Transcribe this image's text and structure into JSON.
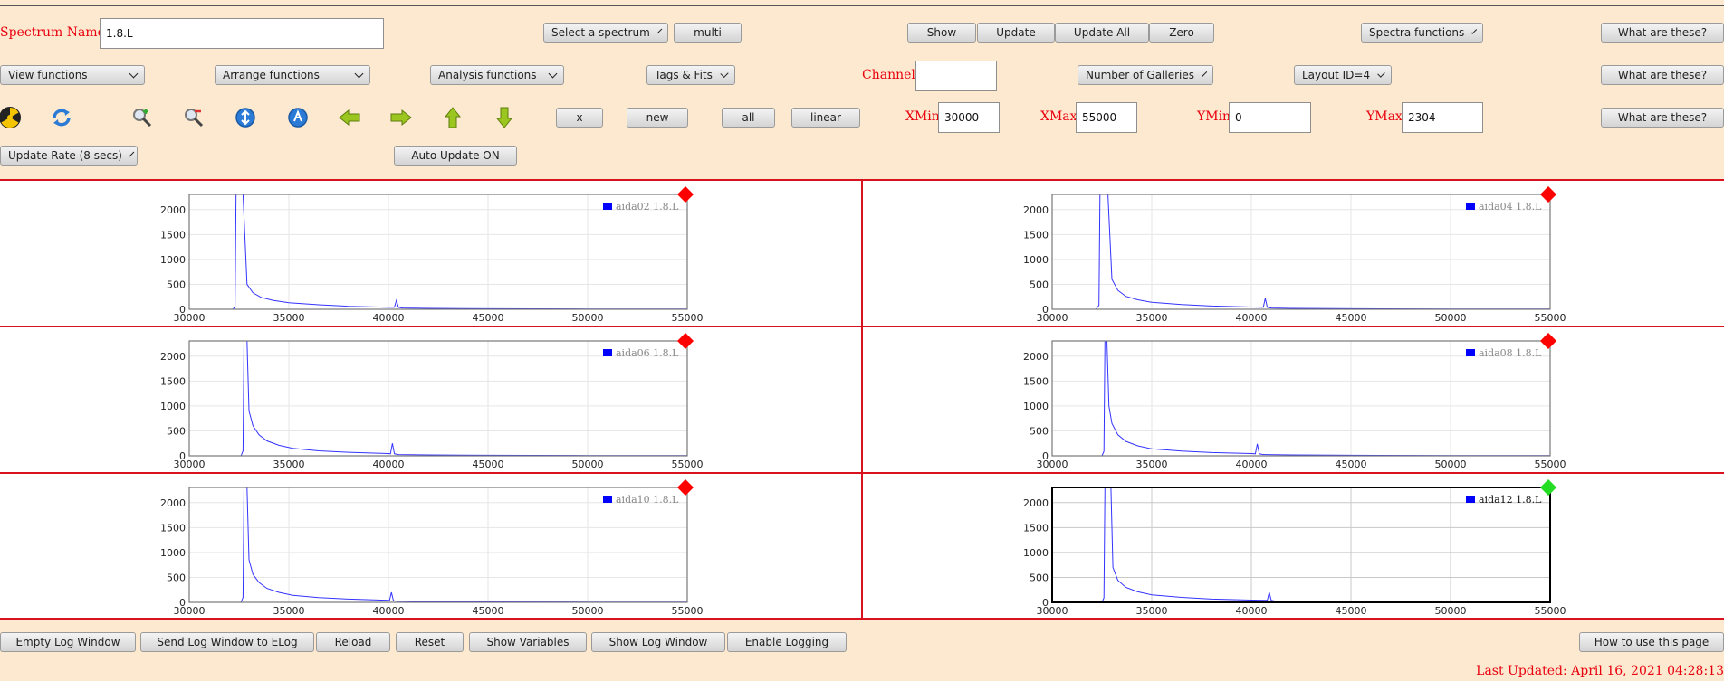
{
  "toolbar": {
    "spectrum_name_label": "Spectrum Name:",
    "spectrum_name_value": "1.8.L",
    "select_spectrum": "Select a spectrum",
    "multi": "multi",
    "show": "Show",
    "update": "Update",
    "update_all": "Update All",
    "zero": "Zero",
    "spectra_functions": "Spectra functions",
    "what_are_these": "What are these?",
    "view_functions": "View functions",
    "arrange_functions": "Arrange functions",
    "analysis_functions": "Analysis functions",
    "tags_fits": "Tags & Fits",
    "channel_label": "Channel:",
    "channel_value": "",
    "number_of_galleries": "Number of Galleries",
    "layout": "Layout ID=4",
    "x": "x",
    "new": "new",
    "all": "all",
    "linear": "linear",
    "xmin_label": "XMin",
    "xmin_value": "30000",
    "xmax_label": "XMax",
    "xmax_value": "55000",
    "ymin_label": "YMin",
    "ymin_value": "0",
    "ymax_label": "YMax",
    "ymax_value": "2304",
    "update_rate": "Update Rate (8 secs)",
    "auto_update": "Auto Update ON"
  },
  "icons": [
    "radiation-icon",
    "refresh-icon",
    "zoom-in-icon",
    "zoom-out-icon",
    "expand-x-icon",
    "expand-y-icon",
    "arrow-left-icon",
    "arrow-right-icon",
    "arrow-up-icon",
    "arrow-down-icon"
  ],
  "footer": {
    "empty_log": "Empty Log Window",
    "send_log": "Send Log Window to ELog",
    "reload": "Reload",
    "reset": "Reset",
    "show_variables": "Show Variables",
    "show_log": "Show Log Window",
    "enable_logging": "Enable Logging",
    "how_to": "How to use this page",
    "last_updated": "Last Updated: April 16, 2021 04:28:13"
  },
  "colors": {
    "background": "#fde9cf",
    "label_red": "#e8000e",
    "series": "#3333ff",
    "divider": "#d8121e",
    "marker_red": "#ff0000",
    "marker_green": "#22dd22"
  },
  "chart_data": [
    {
      "type": "line",
      "legend": "aida02 1.8.L",
      "marker": "red",
      "selected": false,
      "xlim": [
        30000,
        55000
      ],
      "ylim": [
        0,
        2304
      ],
      "x_ticks": [
        "30000",
        "35000",
        "40000",
        "45000",
        "50000",
        "55000"
      ],
      "y_ticks": [
        "0",
        "500",
        "1000",
        "1500",
        "2000"
      ],
      "series": [
        {
          "name": "aida02 1.8.L",
          "x": [
            30000,
            32200,
            32300,
            32350,
            32400,
            32550,
            32600,
            32700,
            32900,
            33200,
            33600,
            34200,
            35000,
            36500,
            38000,
            40000,
            40300,
            40400,
            40500,
            40700,
            42000,
            45000,
            50000,
            55000
          ],
          "y": [
            0,
            0,
            60,
            2304,
            2304,
            2304,
            2304,
            2304,
            500,
            330,
            240,
            180,
            130,
            90,
            60,
            40,
            40,
            180,
            40,
            25,
            18,
            10,
            6,
            4
          ]
        }
      ]
    },
    {
      "type": "line",
      "legend": "aida04 1.8.L",
      "marker": "red",
      "selected": false,
      "xlim": [
        30000,
        55000
      ],
      "ylim": [
        0,
        2304
      ],
      "x_ticks": [
        "30000",
        "35000",
        "40000",
        "45000",
        "50000",
        "55000"
      ],
      "y_ticks": [
        "0",
        "500",
        "1000",
        "1500",
        "2000"
      ],
      "series": [
        {
          "name": "aida04 1.8.L",
          "x": [
            30000,
            32200,
            32350,
            32400,
            32500,
            32600,
            32700,
            32800,
            33000,
            33300,
            33700,
            34300,
            35000,
            36500,
            38000,
            40000,
            40600,
            40700,
            40800,
            41000,
            42000,
            45000,
            50000,
            55000
          ],
          "y": [
            0,
            0,
            80,
            2304,
            2304,
            2304,
            2304,
            2304,
            600,
            380,
            260,
            190,
            140,
            95,
            65,
            45,
            40,
            220,
            40,
            25,
            18,
            10,
            6,
            4
          ]
        }
      ]
    },
    {
      "type": "line",
      "legend": "aida06 1.8.L",
      "marker": "red",
      "selected": false,
      "xlim": [
        30000,
        55000
      ],
      "ylim": [
        0,
        2304
      ],
      "x_ticks": [
        "30000",
        "35000",
        "40000",
        "45000",
        "50000",
        "55000"
      ],
      "y_ticks": [
        "0",
        "500",
        "1000",
        "1500",
        "2000"
      ],
      "series": [
        {
          "name": "aida06 1.8.L",
          "x": [
            30000,
            32600,
            32700,
            32750,
            32900,
            33000,
            33200,
            33500,
            33900,
            34500,
            35200,
            36500,
            38000,
            40000,
            40100,
            40200,
            40300,
            40500,
            42000,
            45000,
            50000,
            55000
          ],
          "y": [
            0,
            0,
            100,
            2304,
            2304,
            900,
            600,
            420,
            300,
            210,
            150,
            100,
            70,
            45,
            40,
            250,
            40,
            25,
            18,
            10,
            6,
            4
          ]
        }
      ]
    },
    {
      "type": "line",
      "legend": "aida08 1.8.L",
      "marker": "red",
      "selected": false,
      "xlim": [
        30000,
        55000
      ],
      "ylim": [
        0,
        2304
      ],
      "x_ticks": [
        "30000",
        "35000",
        "40000",
        "45000",
        "50000",
        "55000"
      ],
      "y_ticks": [
        "0",
        "500",
        "1000",
        "1500",
        "2000"
      ],
      "series": [
        {
          "name": "aida08 1.8.L",
          "x": [
            30000,
            32500,
            32600,
            32650,
            32750,
            32850,
            33000,
            33300,
            33700,
            34300,
            35000,
            36500,
            38000,
            40000,
            40200,
            40300,
            40400,
            40600,
            42000,
            45000,
            50000,
            55000
          ],
          "y": [
            0,
            0,
            90,
            2304,
            2304,
            1000,
            650,
            420,
            290,
            200,
            140,
            95,
            65,
            45,
            40,
            240,
            40,
            25,
            18,
            10,
            6,
            4
          ]
        }
      ]
    },
    {
      "type": "line",
      "legend": "aida10 1.8.L",
      "marker": "red",
      "selected": false,
      "xlim": [
        30000,
        55000
      ],
      "ylim": [
        0,
        2304
      ],
      "x_ticks": [
        "30000",
        "35000",
        "40000",
        "45000",
        "50000",
        "55000"
      ],
      "y_ticks": [
        "0",
        "500",
        "1000",
        "1500",
        "2000"
      ],
      "series": [
        {
          "name": "aida10 1.8.L",
          "x": [
            30000,
            32600,
            32700,
            32750,
            32900,
            33000,
            33200,
            33500,
            33900,
            34500,
            35200,
            36500,
            38000,
            40000,
            40050,
            40150,
            40250,
            40400,
            42000,
            45000,
            50000,
            55000
          ],
          "y": [
            0,
            0,
            100,
            2304,
            2304,
            850,
            560,
            400,
            280,
            200,
            140,
            95,
            65,
            40,
            35,
            200,
            35,
            22,
            15,
            9,
            5,
            3
          ]
        }
      ]
    },
    {
      "type": "line",
      "legend": "aida12 1.8.L",
      "marker": "green",
      "selected": true,
      "xlim": [
        30000,
        55000
      ],
      "ylim": [
        0,
        2304
      ],
      "x_ticks": [
        "30000",
        "35000",
        "40000",
        "45000",
        "50000",
        "55000"
      ],
      "y_ticks": [
        "0",
        "500",
        "1000",
        "1500",
        "2000"
      ],
      "series": [
        {
          "name": "aida12 1.8.L",
          "x": [
            30000,
            32500,
            32600,
            32650,
            32750,
            32850,
            32950,
            33050,
            33300,
            33700,
            34300,
            35000,
            36500,
            38000,
            40000,
            40800,
            40900,
            41000,
            41200,
            42000,
            45000,
            50000,
            55000
          ],
          "y": [
            0,
            0,
            90,
            2304,
            2304,
            2304,
            2304,
            700,
            440,
            300,
            210,
            150,
            100,
            65,
            45,
            40,
            200,
            40,
            25,
            18,
            10,
            6,
            4
          ]
        }
      ]
    }
  ]
}
